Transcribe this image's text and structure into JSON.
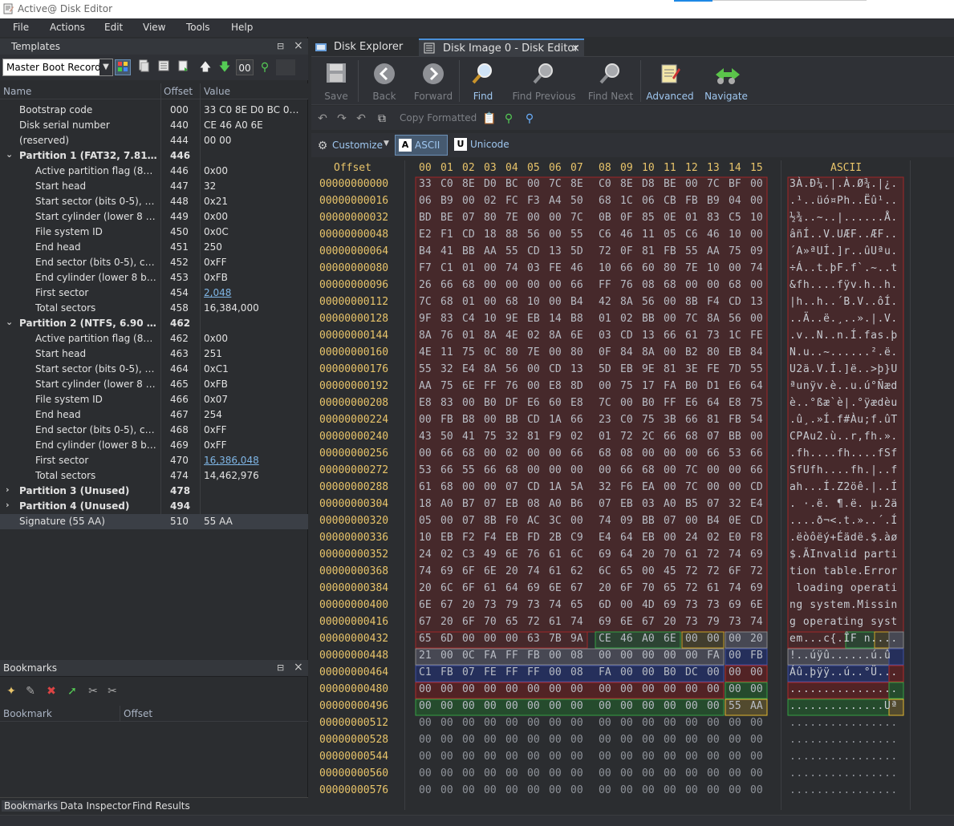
{
  "window": {
    "title": "Active@ Disk Editor"
  },
  "menu": [
    "File",
    "Actions",
    "Edit",
    "View",
    "Tools",
    "Help"
  ],
  "templates": {
    "title": "Templates",
    "selected_template": "Master Boot Record",
    "offset_box": "00",
    "columns": {
      "name": "Name",
      "offset": "Offset",
      "value": "Value"
    },
    "rows": [
      {
        "name": "Bootstrap code",
        "offset": "000",
        "value": "33 C0 8E D0 BC 00 ...",
        "level": 1
      },
      {
        "name": "Disk serial number",
        "offset": "440",
        "value": "CE 46 A0 6E",
        "level": 1
      },
      {
        "name": "(reserved)",
        "offset": "444",
        "value": "00 00",
        "level": 1
      },
      {
        "name": "Partition 1 (FAT32, 7.81 GB)",
        "offset": "446",
        "value": "",
        "level": 0,
        "group": true,
        "expanded": true
      },
      {
        "name": "Active partition flag (80 =...",
        "offset": "446",
        "value": "0x00",
        "level": 2
      },
      {
        "name": "Start head",
        "offset": "447",
        "value": "32",
        "level": 2
      },
      {
        "name": "Start sector (bits 0-5), cyli...",
        "offset": "448",
        "value": "0x21",
        "level": 2
      },
      {
        "name": "Start cylinder (lower 8 bits)",
        "offset": "449",
        "value": "0x00",
        "level": 2
      },
      {
        "name": "File system ID",
        "offset": "450",
        "value": "0x0C",
        "level": 2
      },
      {
        "name": "End head",
        "offset": "451",
        "value": "250",
        "level": 2
      },
      {
        "name": "End sector (bits 0-5), cylin...",
        "offset": "452",
        "value": "0xFF",
        "level": 2
      },
      {
        "name": "End cylinder (lower 8 bits)",
        "offset": "453",
        "value": "0xFB",
        "level": 2
      },
      {
        "name": "First sector",
        "offset": "454",
        "value": "2,048",
        "level": 2,
        "link": true
      },
      {
        "name": "Total sectors",
        "offset": "458",
        "value": "16,384,000",
        "level": 2
      },
      {
        "name": "Partition 2 (NTFS, 6.90 GB)",
        "offset": "462",
        "value": "",
        "level": 0,
        "group": true,
        "expanded": true
      },
      {
        "name": "Active partition flag (80 =...",
        "offset": "462",
        "value": "0x00",
        "level": 2
      },
      {
        "name": "Start head",
        "offset": "463",
        "value": "251",
        "level": 2
      },
      {
        "name": "Start sector (bits 0-5), cyli...",
        "offset": "464",
        "value": "0xC1",
        "level": 2
      },
      {
        "name": "Start cylinder (lower 8 bits)",
        "offset": "465",
        "value": "0xFB",
        "level": 2
      },
      {
        "name": "File system ID",
        "offset": "466",
        "value": "0x07",
        "level": 2
      },
      {
        "name": "End head",
        "offset": "467",
        "value": "254",
        "level": 2
      },
      {
        "name": "End sector (bits 0-5), cylin...",
        "offset": "468",
        "value": "0xFF",
        "level": 2
      },
      {
        "name": "End cylinder (lower 8 bits)",
        "offset": "469",
        "value": "0xFF",
        "level": 2
      },
      {
        "name": "First sector",
        "offset": "470",
        "value": "16,386,048",
        "level": 2,
        "link": true
      },
      {
        "name": "Total sectors",
        "offset": "474",
        "value": "14,462,976",
        "level": 2
      },
      {
        "name": "Partition 3 (Unused)",
        "offset": "478",
        "value": "",
        "level": 0,
        "group": true,
        "expanded": false
      },
      {
        "name": "Partition 4 (Unused)",
        "offset": "494",
        "value": "",
        "level": 0,
        "group": true,
        "expanded": false
      },
      {
        "name": "Signature (55 AA)",
        "offset": "510",
        "value": "55 AA",
        "level": 1,
        "selected": true
      }
    ]
  },
  "bookmarks": {
    "title": "Bookmarks",
    "columns": {
      "bookmark": "Bookmark",
      "offset": "Offset"
    }
  },
  "bottom_tabs": [
    "Bookmarks",
    "Data Inspector",
    "Find Results"
  ],
  "doc_tabs": [
    "Disk Explorer",
    "Disk Image 0 - Disk Editor"
  ],
  "ribbon": {
    "save": "Save",
    "back": "Back",
    "forward": "Forward",
    "find": "Find",
    "find_previous": "Find Previous",
    "find_next": "Find Next",
    "advanced": "Advanced",
    "navigate": "Navigate"
  },
  "toolbar2": {
    "copy_formatted": "Copy Formatted"
  },
  "toolbar3": {
    "customize": "Customize",
    "ascii": "ASCII",
    "unicode": "Unicode"
  },
  "hex": {
    "offset_header": "Offset",
    "ascii_header": "ASCII",
    "col_headers": [
      "00",
      "01",
      "02",
      "03",
      "04",
      "05",
      "06",
      "07",
      "08",
      "09",
      "10",
      "11",
      "12",
      "13",
      "14",
      "15"
    ],
    "rows": [
      {
        "offset": "00000000000",
        "bytes": [
          "33",
          "C0",
          "8E",
          "D0",
          "BC",
          "00",
          "7C",
          "8E",
          "C0",
          "8E",
          "D8",
          "BE",
          "00",
          "7C",
          "BF",
          "00"
        ],
        "ascii": "3À.Ð¼.|.À.Ø¾.|¿."
      },
      {
        "offset": "00000000016",
        "bytes": [
          "06",
          "B9",
          "00",
          "02",
          "FC",
          "F3",
          "A4",
          "50",
          "68",
          "1C",
          "06",
          "CB",
          "FB",
          "B9",
          "04",
          "00"
        ],
        "ascii": ".¹..üó¤Ph..Ëû¹.."
      },
      {
        "offset": "00000000032",
        "bytes": [
          "BD",
          "BE",
          "07",
          "80",
          "7E",
          "00",
          "00",
          "7C",
          "0B",
          "0F",
          "85",
          "0E",
          "01",
          "83",
          "C5",
          "10"
        ],
        "ascii": "½¾..~..|......Å."
      },
      {
        "offset": "00000000048",
        "bytes": [
          "E2",
          "F1",
          "CD",
          "18",
          "88",
          "56",
          "00",
          "55",
          "C6",
          "46",
          "11",
          "05",
          "C6",
          "46",
          "10",
          "00"
        ],
        "ascii": "âñÍ..V.UÆF..ÆF.."
      },
      {
        "offset": "00000000064",
        "bytes": [
          "B4",
          "41",
          "BB",
          "AA",
          "55",
          "CD",
          "13",
          "5D",
          "72",
          "0F",
          "81",
          "FB",
          "55",
          "AA",
          "75",
          "09"
        ],
        "ascii": "´A»ªUÍ.]r..ûUªu."
      },
      {
        "offset": "00000000080",
        "bytes": [
          "F7",
          "C1",
          "01",
          "00",
          "74",
          "03",
          "FE",
          "46",
          "10",
          "66",
          "60",
          "80",
          "7E",
          "10",
          "00",
          "74"
        ],
        "ascii": "÷Á..t.þF.f`.~..t"
      },
      {
        "offset": "00000000096",
        "bytes": [
          "26",
          "66",
          "68",
          "00",
          "00",
          "00",
          "00",
          "66",
          "FF",
          "76",
          "08",
          "68",
          "00",
          "00",
          "68",
          "00"
        ],
        "ascii": "&fh....fÿv.h..h."
      },
      {
        "offset": "00000000112",
        "bytes": [
          "7C",
          "68",
          "01",
          "00",
          "68",
          "10",
          "00",
          "B4",
          "42",
          "8A",
          "56",
          "00",
          "8B",
          "F4",
          "CD",
          "13"
        ],
        "ascii": "|h..h..´B.V..ôÍ."
      },
      {
        "offset": "00000000128",
        "bytes": [
          "9F",
          "83",
          "C4",
          "10",
          "9E",
          "EB",
          "14",
          "B8",
          "01",
          "02",
          "BB",
          "00",
          "7C",
          "8A",
          "56",
          "00"
        ],
        "ascii": "..Ä..ë.¸..».|.V."
      },
      {
        "offset": "00000000144",
        "bytes": [
          "8A",
          "76",
          "01",
          "8A",
          "4E",
          "02",
          "8A",
          "6E",
          "03",
          "CD",
          "13",
          "66",
          "61",
          "73",
          "1C",
          "FE"
        ],
        "ascii": ".v..N..n.Í.fas.þ"
      },
      {
        "offset": "00000000160",
        "bytes": [
          "4E",
          "11",
          "75",
          "0C",
          "80",
          "7E",
          "00",
          "80",
          "0F",
          "84",
          "8A",
          "00",
          "B2",
          "80",
          "EB",
          "84"
        ],
        "ascii": "N.u..~......².ë."
      },
      {
        "offset": "00000000176",
        "bytes": [
          "55",
          "32",
          "E4",
          "8A",
          "56",
          "00",
          "CD",
          "13",
          "5D",
          "EB",
          "9E",
          "81",
          "3E",
          "FE",
          "7D",
          "55"
        ],
        "ascii": "U2ä.V.Í.]ë..>þ}U"
      },
      {
        "offset": "00000000192",
        "bytes": [
          "AA",
          "75",
          "6E",
          "FF",
          "76",
          "00",
          "E8",
          "8D",
          "00",
          "75",
          "17",
          "FA",
          "B0",
          "D1",
          "E6",
          "64"
        ],
        "ascii": "ªunÿv.è..u.ú°Ñæd"
      },
      {
        "offset": "00000000208",
        "bytes": [
          "E8",
          "83",
          "00",
          "B0",
          "DF",
          "E6",
          "60",
          "E8",
          "7C",
          "00",
          "B0",
          "FF",
          "E6",
          "64",
          "E8",
          "75"
        ],
        "ascii": "è..°ßæ`è|.°ÿædèu"
      },
      {
        "offset": "00000000224",
        "bytes": [
          "00",
          "FB",
          "B8",
          "00",
          "BB",
          "CD",
          "1A",
          "66",
          "23",
          "C0",
          "75",
          "3B",
          "66",
          "81",
          "FB",
          "54"
        ],
        "ascii": ".û¸.»Í.f#Àu;f.ûT"
      },
      {
        "offset": "00000000240",
        "bytes": [
          "43",
          "50",
          "41",
          "75",
          "32",
          "81",
          "F9",
          "02",
          "01",
          "72",
          "2C",
          "66",
          "68",
          "07",
          "BB",
          "00"
        ],
        "ascii": "CPAu2.ù..r,fh.»."
      },
      {
        "offset": "00000000256",
        "bytes": [
          "00",
          "66",
          "68",
          "00",
          "02",
          "00",
          "00",
          "66",
          "68",
          "08",
          "00",
          "00",
          "00",
          "66",
          "53",
          "66"
        ],
        "ascii": ".fh....fh....fSf"
      },
      {
        "offset": "00000000272",
        "bytes": [
          "53",
          "66",
          "55",
          "66",
          "68",
          "00",
          "00",
          "00",
          "00",
          "66",
          "68",
          "00",
          "7C",
          "00",
          "00",
          "66"
        ],
        "ascii": "SfUfh....fh.|..f"
      },
      {
        "offset": "00000000288",
        "bytes": [
          "61",
          "68",
          "00",
          "00",
          "07",
          "CD",
          "1A",
          "5A",
          "32",
          "F6",
          "EA",
          "00",
          "7C",
          "00",
          "00",
          "CD"
        ],
        "ascii": "ah...Í.Z2öê.|..Í"
      },
      {
        "offset": "00000000304",
        "bytes": [
          "18",
          "A0",
          "B7",
          "07",
          "EB",
          "08",
          "A0",
          "B6",
          "07",
          "EB",
          "03",
          "A0",
          "B5",
          "07",
          "32",
          "E4"
        ],
        "ascii": ". ·.ë. ¶.ë. µ.2ä"
      },
      {
        "offset": "00000000320",
        "bytes": [
          "05",
          "00",
          "07",
          "8B",
          "F0",
          "AC",
          "3C",
          "00",
          "74",
          "09",
          "BB",
          "07",
          "00",
          "B4",
          "0E",
          "CD"
        ],
        "ascii": "....ð¬<.t.»..´.Í"
      },
      {
        "offset": "00000000336",
        "bytes": [
          "10",
          "EB",
          "F2",
          "F4",
          "EB",
          "FD",
          "2B",
          "C9",
          "E4",
          "64",
          "EB",
          "00",
          "24",
          "02",
          "E0",
          "F8"
        ],
        "ascii": ".ëòôëý+Éädë.$.àø"
      },
      {
        "offset": "00000000352",
        "bytes": [
          "24",
          "02",
          "C3",
          "49",
          "6E",
          "76",
          "61",
          "6C",
          "69",
          "64",
          "20",
          "70",
          "61",
          "72",
          "74",
          "69"
        ],
        "ascii": "$.ÃInvalid parti"
      },
      {
        "offset": "00000000368",
        "bytes": [
          "74",
          "69",
          "6F",
          "6E",
          "20",
          "74",
          "61",
          "62",
          "6C",
          "65",
          "00",
          "45",
          "72",
          "72",
          "6F",
          "72"
        ],
        "ascii": "tion table.Error"
      },
      {
        "offset": "00000000384",
        "bytes": [
          "20",
          "6C",
          "6F",
          "61",
          "64",
          "69",
          "6E",
          "67",
          "20",
          "6F",
          "70",
          "65",
          "72",
          "61",
          "74",
          "69"
        ],
        "ascii": " loading operati"
      },
      {
        "offset": "00000000400",
        "bytes": [
          "6E",
          "67",
          "20",
          "73",
          "79",
          "73",
          "74",
          "65",
          "6D",
          "00",
          "4D",
          "69",
          "73",
          "73",
          "69",
          "6E"
        ],
        "ascii": "ng system.Missin"
      },
      {
        "offset": "00000000416",
        "bytes": [
          "67",
          "20",
          "6F",
          "70",
          "65",
          "72",
          "61",
          "74",
          "69",
          "6E",
          "67",
          "20",
          "73",
          "79",
          "73",
          "74"
        ],
        "ascii": "g operating syst"
      },
      {
        "offset": "00000000432",
        "bytes": [
          "65",
          "6D",
          "00",
          "00",
          "00",
          "63",
          "7B",
          "9A",
          "CE",
          "46",
          "A0",
          "6E",
          "00",
          "00",
          "00",
          "20"
        ],
        "ascii": "em...c{.ÎF n...."
      },
      {
        "offset": "00000000448",
        "bytes": [
          "21",
          "00",
          "0C",
          "FA",
          "FF",
          "FB",
          "00",
          "08",
          "00",
          "00",
          "00",
          "00",
          "00",
          "FA",
          "00",
          "FB"
        ],
        "ascii": "!..úÿû......ú.û"
      },
      {
        "offset": "00000000464",
        "bytes": [
          "C1",
          "FB",
          "07",
          "FE",
          "FF",
          "FF",
          "00",
          "08",
          "FA",
          "00",
          "00",
          "B0",
          "DC",
          "00",
          "00",
          "00"
        ],
        "ascii": "Áû.þÿÿ..ú..°Ü..."
      },
      {
        "offset": "00000000480",
        "bytes": [
          "00",
          "00",
          "00",
          "00",
          "00",
          "00",
          "00",
          "00",
          "00",
          "00",
          "00",
          "00",
          "00",
          "00",
          "00",
          "00"
        ],
        "ascii": "................"
      },
      {
        "offset": "00000000496",
        "bytes": [
          "00",
          "00",
          "00",
          "00",
          "00",
          "00",
          "00",
          "00",
          "00",
          "00",
          "00",
          "00",
          "00",
          "00",
          "55",
          "AA"
        ],
        "ascii": "..............Uª"
      },
      {
        "offset": "00000000512",
        "bytes": [
          "00",
          "00",
          "00",
          "00",
          "00",
          "00",
          "00",
          "00",
          "00",
          "00",
          "00",
          "00",
          "00",
          "00",
          "00",
          "00"
        ],
        "ascii": "................",
        "empty": true
      },
      {
        "offset": "00000000528",
        "bytes": [
          "00",
          "00",
          "00",
          "00",
          "00",
          "00",
          "00",
          "00",
          "00",
          "00",
          "00",
          "00",
          "00",
          "00",
          "00",
          "00"
        ],
        "ascii": "................",
        "empty": true
      },
      {
        "offset": "00000000544",
        "bytes": [
          "00",
          "00",
          "00",
          "00",
          "00",
          "00",
          "00",
          "00",
          "00",
          "00",
          "00",
          "00",
          "00",
          "00",
          "00",
          "00"
        ],
        "ascii": "................",
        "empty": true
      },
      {
        "offset": "00000000560",
        "bytes": [
          "00",
          "00",
          "00",
          "00",
          "00",
          "00",
          "00",
          "00",
          "00",
          "00",
          "00",
          "00",
          "00",
          "00",
          "00",
          "00"
        ],
        "ascii": "................",
        "empty": true
      },
      {
        "offset": "00000000576",
        "bytes": [
          "00",
          "00",
          "00",
          "00",
          "00",
          "00",
          "00",
          "00",
          "00",
          "00",
          "00",
          "00",
          "00",
          "00",
          "00",
          "00"
        ],
        "ascii": "................",
        "empty": true
      }
    ]
  },
  "colors": {
    "bootstrap_region": "#8b2222",
    "partition1": "#5a5a6a",
    "partition2": "#243066",
    "partition3": "#7a1a1a",
    "partition4": "#1f6a2a",
    "signature": "#c9a227",
    "serial": "#2f8a3a",
    "accent": "#4a90d9"
  }
}
